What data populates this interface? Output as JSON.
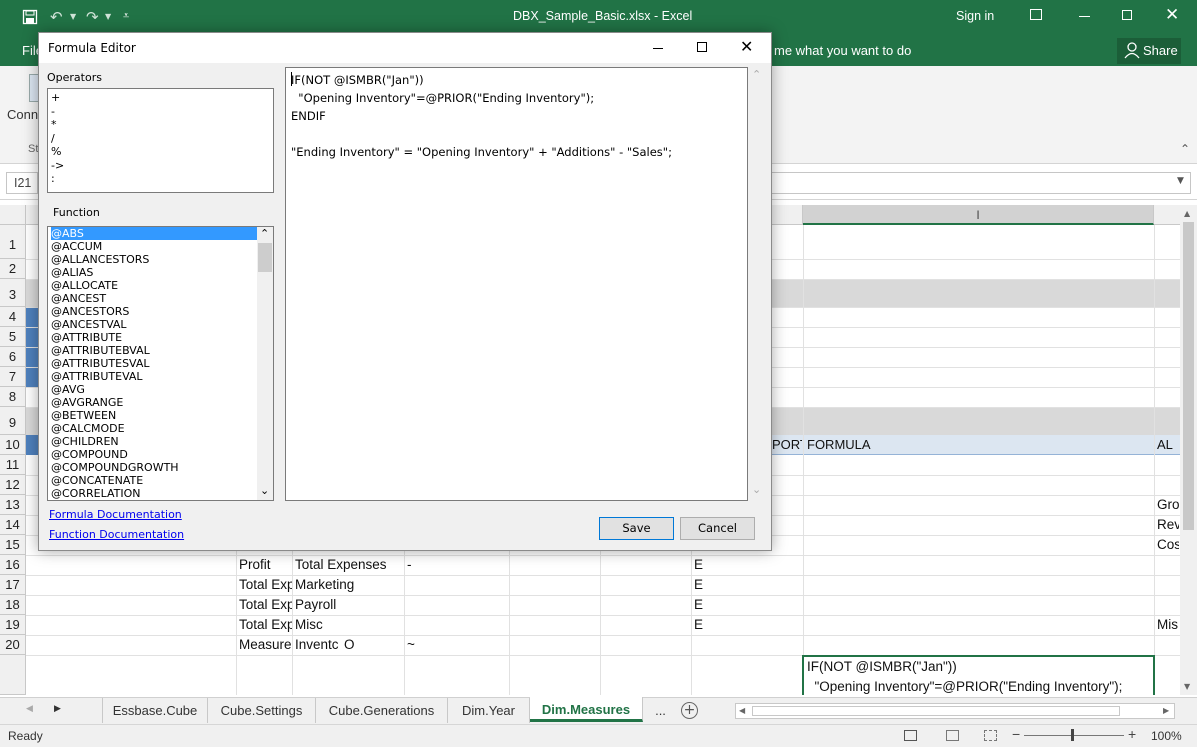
{
  "window": {
    "title": "DBX_Sample_Basic.xlsx - Excel",
    "signin": "Sign in"
  },
  "ribbon": {
    "file_tab": "File",
    "tell_me": "me what you want to do",
    "share": "Share",
    "connect_partial": "Conne",
    "group_partial": "St"
  },
  "formula_bar": {
    "name_box": "I21"
  },
  "grid": {
    "column_I": "I",
    "rows": [
      "1",
      "2",
      "3",
      "4",
      "5",
      "6",
      "7",
      "8",
      "9",
      "10",
      "11",
      "12",
      "13",
      "14",
      "15",
      "16",
      "17",
      "18",
      "19",
      "20"
    ],
    "header_row": {
      "export_partial": "PORT",
      "formula": "FORMULA",
      "alias_partial": "AL"
    },
    "row16": {
      "b": "Profit",
      "c": "Total Expenses",
      "d": "-",
      "g": "E"
    },
    "row17": {
      "b": "Total Exp",
      "c": "Marketing",
      "g": "E"
    },
    "row18": {
      "b": "Total Exp",
      "c": "Payroll",
      "g": "E"
    },
    "row19": {
      "b": "Total Exp",
      "c": "Misc",
      "g": "E",
      "j": "Mis"
    },
    "row20": {
      "b": "Measure",
      "c": "Inventc",
      "c2": "O",
      "d": "~"
    },
    "right_partials": [
      "Gro",
      "Rev",
      "Cos"
    ],
    "formula_cell": [
      "IF(NOT @ISMBR(\"Jan\"))",
      "  \"Opening Inventory\"=@PRIOR(\"Ending Inventory\");"
    ]
  },
  "sheet_tabs": [
    "Essbase.Cube",
    "Cube.Settings",
    "Cube.Generations",
    "Dim.Year",
    "Dim.Measures",
    "..."
  ],
  "active_tab": "Dim.Measures",
  "status": {
    "ready": "Ready",
    "zoom": "100%"
  },
  "dialog": {
    "title": "Formula Editor",
    "operators_label": "Operators",
    "operators": [
      "+",
      "-",
      "*",
      "/",
      "%",
      "->",
      ":"
    ],
    "function_label": "Function",
    "functions": [
      "@ABS",
      "@ACCUM",
      "@ALLANCESTORS",
      "@ALIAS",
      "@ALLOCATE",
      "@ANCEST",
      "@ANCESTORS",
      "@ANCESTVAL",
      "@ATTRIBUTE",
      "@ATTRIBUTEBVAL",
      "@ATTRIBUTESVAL",
      "@ATTRIBUTEVAL",
      "@AVG",
      "@AVGRANGE",
      "@BETWEEN",
      "@CALCMODE",
      "@CHILDREN",
      "@COMPOUND",
      "@COMPOUNDGROWTH",
      "@CONCATENATE",
      "@CORRELATION"
    ],
    "selected_function": "@ABS",
    "editor_lines": [
      "IF(NOT @ISMBR(\"Jan\"))",
      "  \"Opening Inventory\"=@PRIOR(\"Ending Inventory\");",
      "ENDIF",
      "",
      "\"Ending Inventory\" = \"Opening Inventory\" + \"Additions\" - \"Sales\";"
    ],
    "formula_doc_link": "Formula Documentation",
    "function_doc_link": "Function Documentation",
    "save_label": "Save",
    "cancel_label": "Cancel"
  },
  "colors": {
    "excel_green": "#217346",
    "selection": "#3399ff",
    "header_blue": "#4f81bd",
    "section_gray": "#d9d9d9"
  }
}
